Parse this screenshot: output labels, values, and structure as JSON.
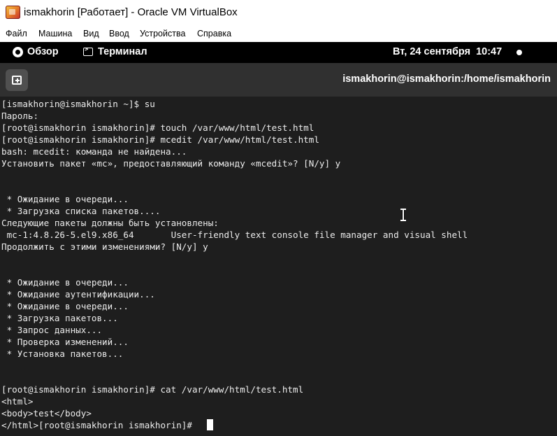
{
  "window": {
    "title": "ismakhorin [Работает] - Oracle VM VirtualBox",
    "logo_icon": "virtualbox-icon"
  },
  "menubar": {
    "items": [
      "Файл",
      "Машина",
      "Вид",
      "Ввод",
      "Устройства",
      "Справка"
    ]
  },
  "gnome_bar": {
    "overview": "Обзор",
    "app": "Терминал",
    "clock": "Вт, 24 сентября  10:47",
    "status_icon": "status-dot-icon"
  },
  "terminal": {
    "title": "ismakhorin@ismakhorin:/home/ismakhorin",
    "new_tab_icon": "new-tab-icon",
    "background": "#1e1e1e",
    "foreground": "#ececec",
    "lines": [
      "[ismakhorin@ismakhorin ~]$ su",
      "Пароль:",
      "[root@ismakhorin ismakhorin]# touch /var/www/html/test.html",
      "[root@ismakhorin ismakhorin]# mcedit /var/www/html/test.html",
      "bash: mcedit: команда не найдена...",
      "Установить пакет «mc», предоставляющий команду «mcedit»? [N/y] y",
      "",
      "",
      " * Ожидание в очереди...",
      " * Загрузка списка пакетов....",
      "Следующие пакеты должны быть установлены:",
      " mc-1:4.8.26-5.el9.x86_64       User-friendly text console file manager and visual shell",
      "Продолжить с этими изменениями? [N/y] y",
      "",
      "",
      " * Ожидание в очереди...",
      " * Ожидание аутентификации...",
      " * Ожидание в очереди...",
      " * Загрузка пакетов...",
      " * Запрос данных...",
      " * Проверка изменений...",
      " * Установка пакетов...",
      "",
      "",
      "[root@ismakhorin ismakhorin]# cat /var/www/html/test.html",
      "<html>",
      "<body>test</body>",
      "</html>[root@ismakhorin ismakhorin]# "
    ]
  }
}
